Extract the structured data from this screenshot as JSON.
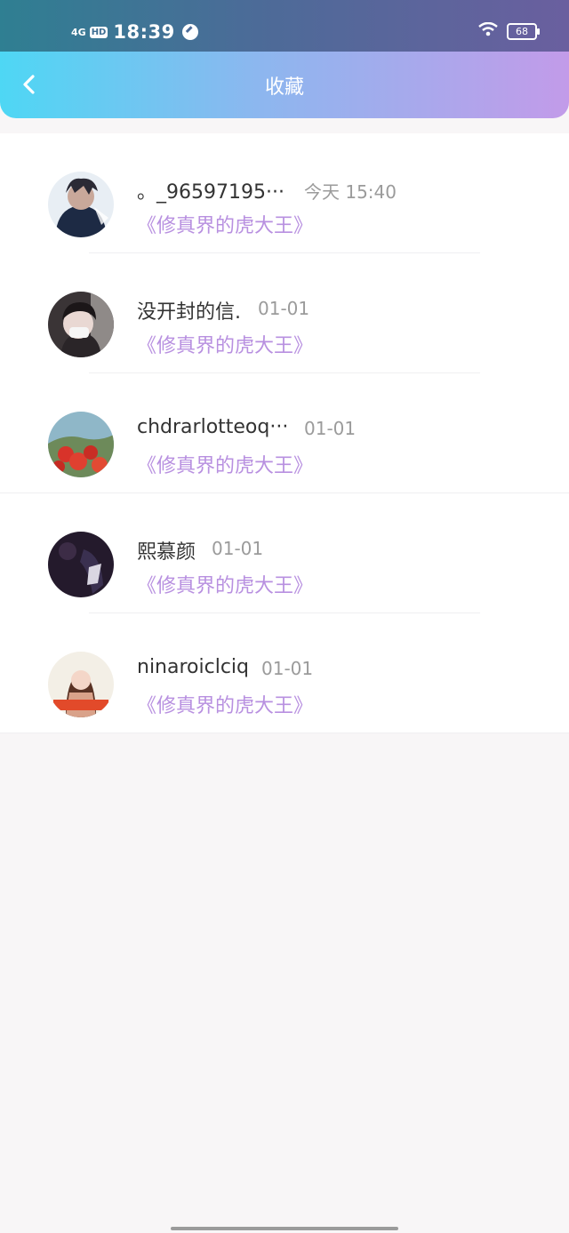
{
  "status_bar": {
    "network": "4G",
    "hd": "HD",
    "time": "18:39",
    "battery": "68"
  },
  "header": {
    "title": "收藏"
  },
  "favorites": [
    {
      "name": "。_96597195···",
      "time": "今天 15:40",
      "book": "《修真界的虎大王》"
    },
    {
      "name": "没开封的信.",
      "time": "01-01",
      "book": "《修真界的虎大王》"
    },
    {
      "name": "chdrarlotteoq···",
      "time": "01-01",
      "book": "《修真界的虎大王》"
    },
    {
      "name": "熙慕颜",
      "time": "01-01",
      "book": "《修真界的虎大王》"
    },
    {
      "name": "ninaroiclciq",
      "time": "01-01",
      "book": "《修真界的虎大王》"
    }
  ],
  "colors": {
    "accent_book_title": "#b890e0",
    "header_gradient_start": "#4ed7f4",
    "header_gradient_end": "#c29be9"
  }
}
